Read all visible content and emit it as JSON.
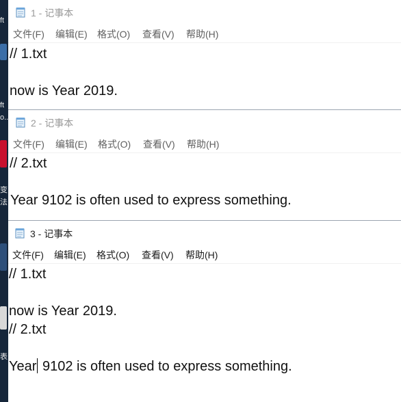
{
  "desktop": {
    "fragments": [
      "ft",
      "ft",
      "o..",
      "变",
      "法:",
      "表"
    ]
  },
  "windows": [
    {
      "title": "1 - 记事本",
      "menu": [
        "文件(F)",
        "编辑(E)",
        "格式(O)",
        "查看(V)",
        "帮助(H)"
      ],
      "lines": [
        "// 1.txt",
        "",
        "now is Year 2019."
      ]
    },
    {
      "title": "2 - 记事本",
      "menu": [
        "文件(F)",
        "编辑(E)",
        "格式(O)",
        "查看(V)",
        "帮助(H)"
      ],
      "lines": [
        "// 2.txt",
        "",
        "Year 9102 is often used to express something."
      ]
    },
    {
      "title": "3 - 记事本",
      "menu": [
        "文件(F)",
        "编辑(E)",
        "格式(O)",
        "查看(V)",
        "帮助(H)"
      ],
      "lines": [
        "// 1.txt",
        "",
        "now is Year 2019.",
        "// 2.txt",
        "",
        "Year",
        " 9102 is often used to express something."
      ]
    }
  ]
}
